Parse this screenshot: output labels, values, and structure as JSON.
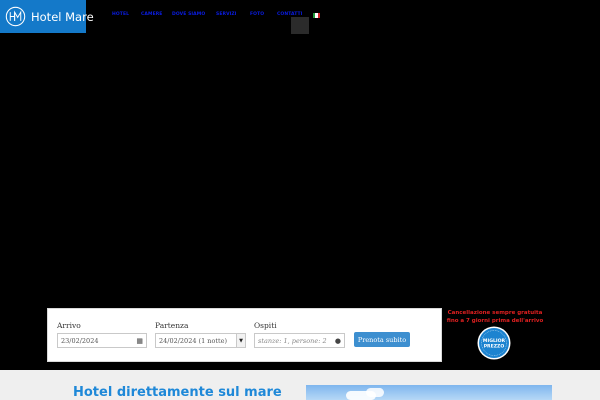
{
  "brand": {
    "name": "Hotel Mare",
    "logo_icon": "hm-monogram-icon",
    "color": "#1479c9"
  },
  "nav": {
    "items": [
      {
        "label": "Hotel"
      },
      {
        "label": "Camere"
      },
      {
        "label": "Dove siamo"
      },
      {
        "label": "Servizi"
      },
      {
        "label": "Foto"
      },
      {
        "label": "Contatti"
      }
    ],
    "language_icon": "italian-flag-icon",
    "link_color": "#0a1de6"
  },
  "booking": {
    "arrival": {
      "label": "Arrivo",
      "value": "23/02/2024",
      "icon": "calendar-icon"
    },
    "departure": {
      "label": "Partenza",
      "value": "24/02/2024 (1 notte)"
    },
    "guests": {
      "label": "Ospiti",
      "placeholder": "stanze: 1, persone: 2",
      "icon": "person-icon"
    },
    "submit_label": "Prenota subito",
    "button_color": "#3d8fd0"
  },
  "promo": {
    "cancellation_line1": "Cancellazione sempre gratuita",
    "cancellation_line2": "fino a 7 giorni prima dell'arrivo",
    "badge_line1": "MIGLIOR",
    "badge_line2": "PREZZO",
    "badge_color": "#1c83d0"
  },
  "intro": {
    "title": "Hotel direttamente sul mare"
  }
}
